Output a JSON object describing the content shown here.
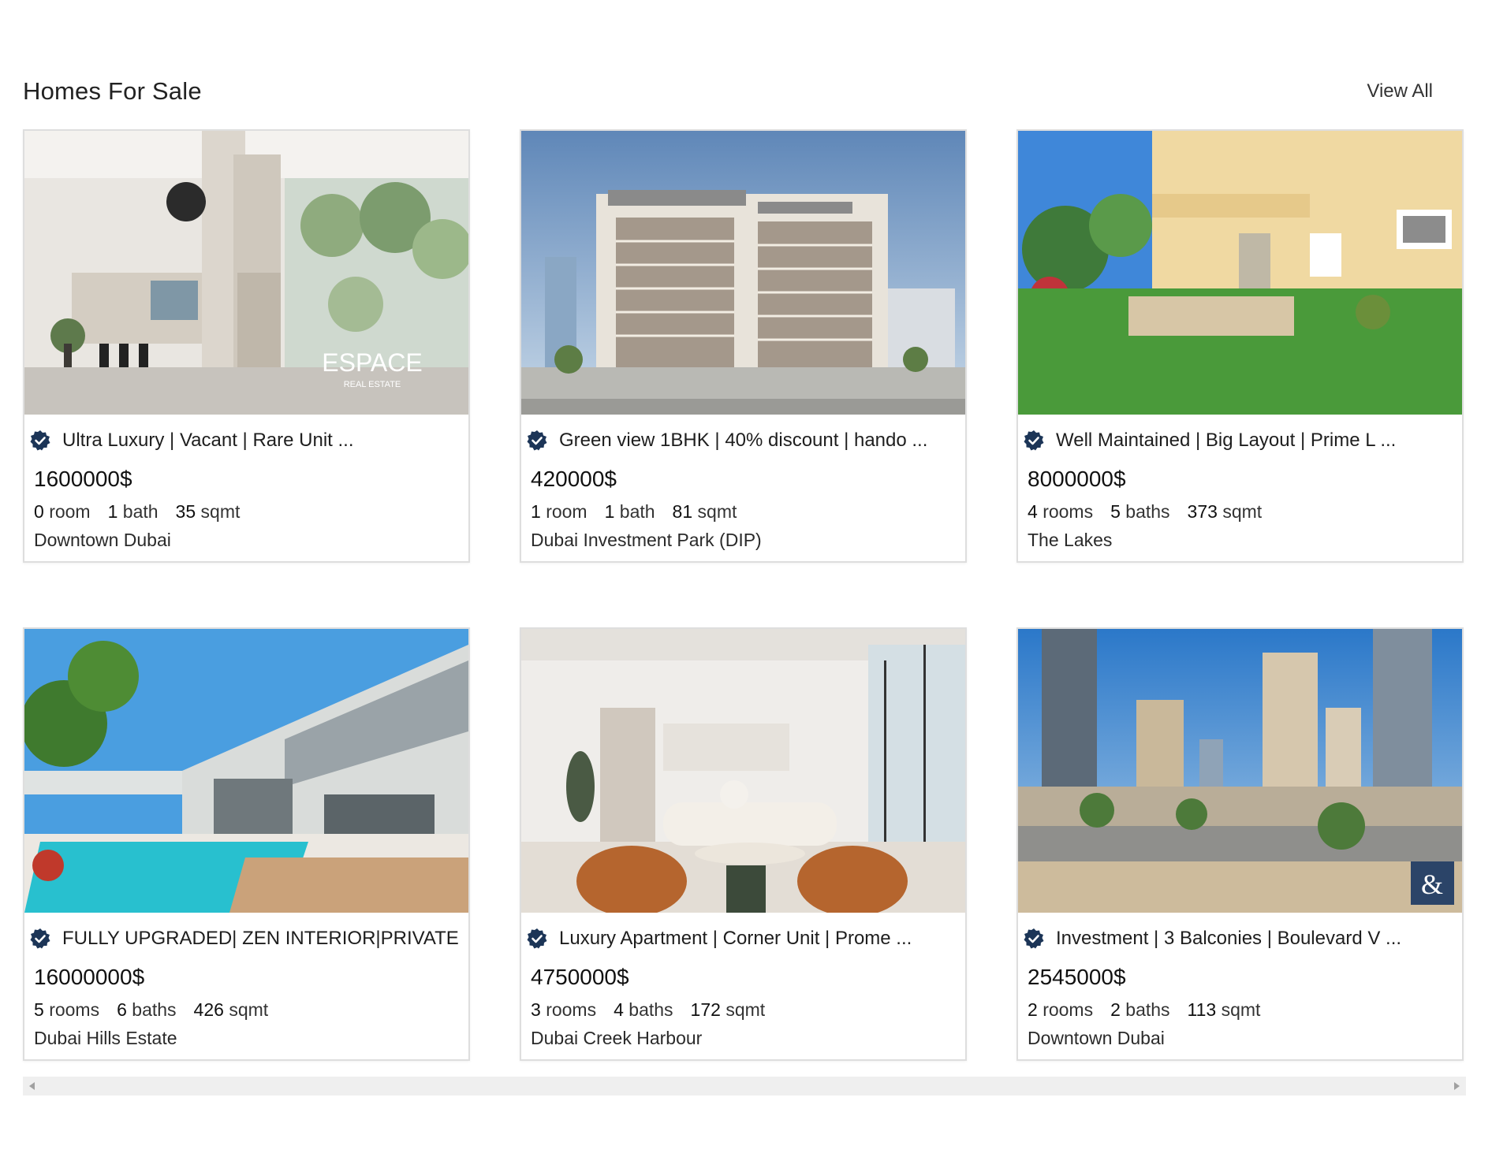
{
  "section": {
    "title": "Homes For Sale",
    "view_all": "View All"
  },
  "colors": {
    "verified_badge": "#1c3557",
    "card_border": "#dedede",
    "scrollbar_track": "#efefef"
  },
  "cards": [
    {
      "title": "Ultra Luxury | Vacant | Rare Unit ...",
      "price": "1600000$",
      "rooms_num": "0",
      "rooms_label": "room",
      "baths_num": "1",
      "baths_label": "bath",
      "sqmt_num": "35",
      "sqmt_label": "sqmt",
      "location": "Downtown Dubai",
      "image_text": "ESPACE",
      "image_subtext": "REAL ESTATE"
    },
    {
      "title": "Green view 1BHK | 40% discount | hando ...",
      "price": "420000$",
      "rooms_num": "1",
      "rooms_label": "room",
      "baths_num": "1",
      "baths_label": "bath",
      "sqmt_num": "81",
      "sqmt_label": "sqmt",
      "location": "Dubai Investment Park (DIP)"
    },
    {
      "title": "Well Maintained | Big Layout | Prime L ...",
      "price": "8000000$",
      "rooms_num": "4",
      "rooms_label": "rooms",
      "baths_num": "5",
      "baths_label": "baths",
      "sqmt_num": "373",
      "sqmt_label": "sqmt",
      "location": "The Lakes"
    },
    {
      "title": "FULLY UPGRADED| ZEN INTERIOR|PRIVATE S ...",
      "price": "16000000$",
      "rooms_num": "5",
      "rooms_label": "rooms",
      "baths_num": "6",
      "baths_label": "baths",
      "sqmt_num": "426",
      "sqmt_label": "sqmt",
      "location": "Dubai Hills Estate"
    },
    {
      "title": "Luxury Apartment | Corner Unit | Prome ...",
      "price": "4750000$",
      "rooms_num": "3",
      "rooms_label": "rooms",
      "baths_num": "4",
      "baths_label": "baths",
      "sqmt_num": "172",
      "sqmt_label": "sqmt",
      "location": "Dubai Creek Harbour"
    },
    {
      "title": "Investment | 3 Balconies | Boulevard V ...",
      "price": "2545000$",
      "rooms_num": "2",
      "rooms_label": "rooms",
      "baths_num": "2",
      "baths_label": "baths",
      "sqmt_num": "113",
      "sqmt_label": "sqmt",
      "location": "Downtown Dubai",
      "image_text": "&"
    }
  ]
}
